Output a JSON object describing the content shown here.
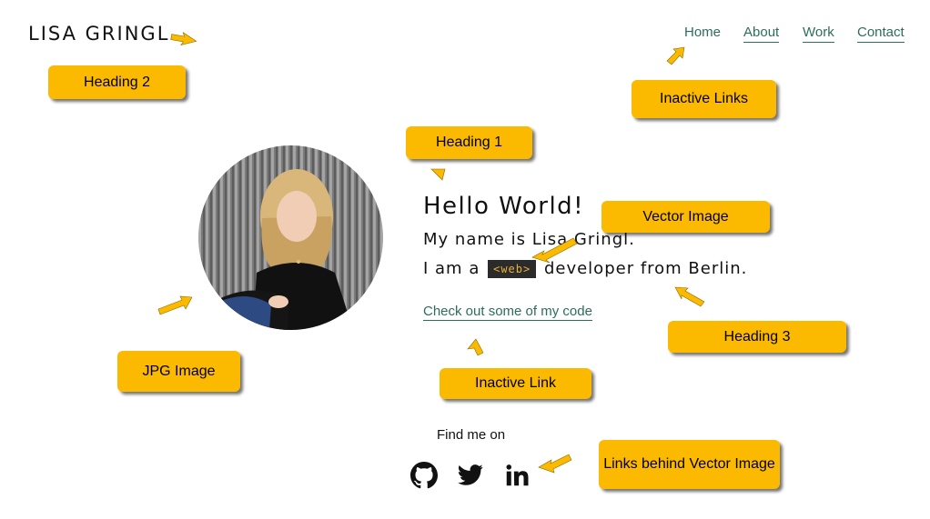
{
  "header": {
    "brand": "LISA GRINGL"
  },
  "nav": {
    "items": [
      "Home",
      "About",
      "Work",
      "Contact"
    ]
  },
  "hero": {
    "title": "Hello World!",
    "name_line": "My name is Lisa Gringl.",
    "role_prefix": "I am a",
    "role_code": "<web>",
    "role_suffix": "developer from Berlin.",
    "code_link": "Check out some of my code"
  },
  "social": {
    "label": "Find me on",
    "icons": [
      "github-icon",
      "twitter-icon",
      "linkedin-icon"
    ]
  },
  "annotations": {
    "heading2": "Heading 2",
    "inactive_links": "Inactive Links",
    "heading1": "Heading 1",
    "vector_image": "Vector Image",
    "heading3": "Heading 3",
    "jpg_image": "JPG Image",
    "inactive_link": "Inactive Link",
    "links_behind_vector": "Links behind Vector Image"
  },
  "colors": {
    "accent": "#2c6e5b",
    "callout": "#fbb900",
    "code_bg": "#2b2b2b",
    "code_text": "#e8b13a"
  }
}
